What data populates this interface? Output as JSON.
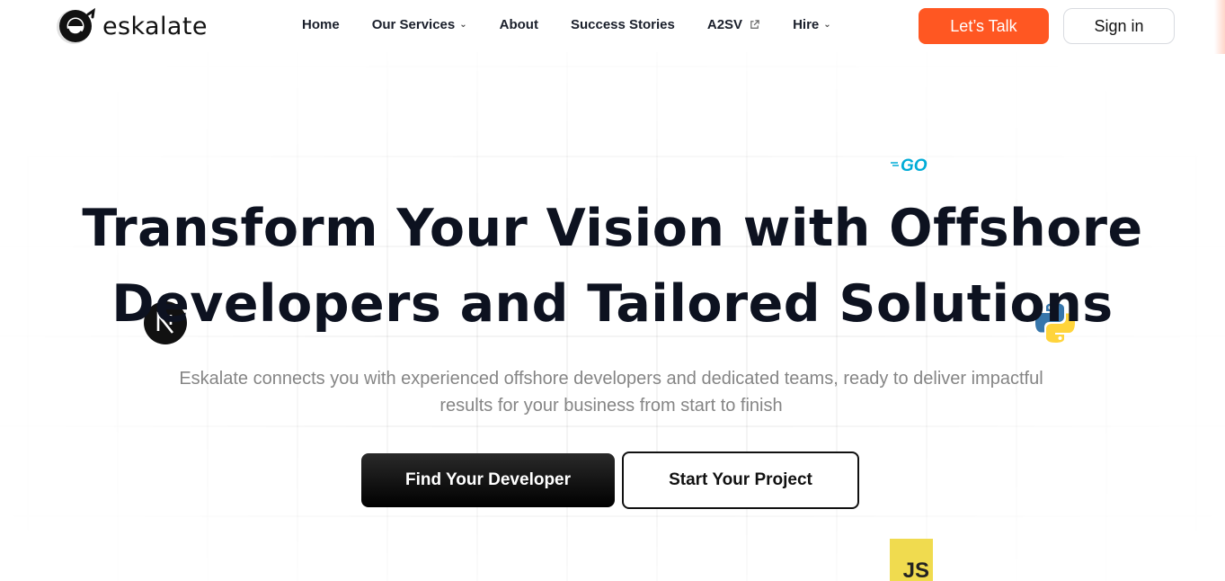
{
  "header": {
    "logo_text": "eskalate",
    "nav": [
      {
        "label": "Home",
        "has_dropdown": false,
        "external": false
      },
      {
        "label": "Our Services",
        "has_dropdown": true,
        "external": false
      },
      {
        "label": "About",
        "has_dropdown": false,
        "external": false
      },
      {
        "label": "Success Stories",
        "has_dropdown": false,
        "external": false
      },
      {
        "label": "A2SV",
        "has_dropdown": false,
        "external": true
      },
      {
        "label": "Hire",
        "has_dropdown": true,
        "external": false
      }
    ],
    "cta_label": "Let’s Talk",
    "signin_label": "Sign in"
  },
  "hero": {
    "title_line1": "Transform Your Vision with Offshore",
    "title_line2": "Developers and Tailored Solutions",
    "subtitle": "Eskalate connects you with experienced offshore developers and dedicated teams, ready to deliver impactful results for your business from start to finish",
    "primary_button": "Find Your Developer",
    "secondary_button": "Start Your Project"
  },
  "tech_icons": {
    "go": "GO",
    "next": "N",
    "js": "JS",
    "python": "python-icon"
  },
  "colors": {
    "accent": "#ff5722",
    "text_dark": "#0d1220",
    "subtitle": "#858585",
    "js_yellow": "#f0db4f",
    "go_blue": "#00acd7"
  }
}
